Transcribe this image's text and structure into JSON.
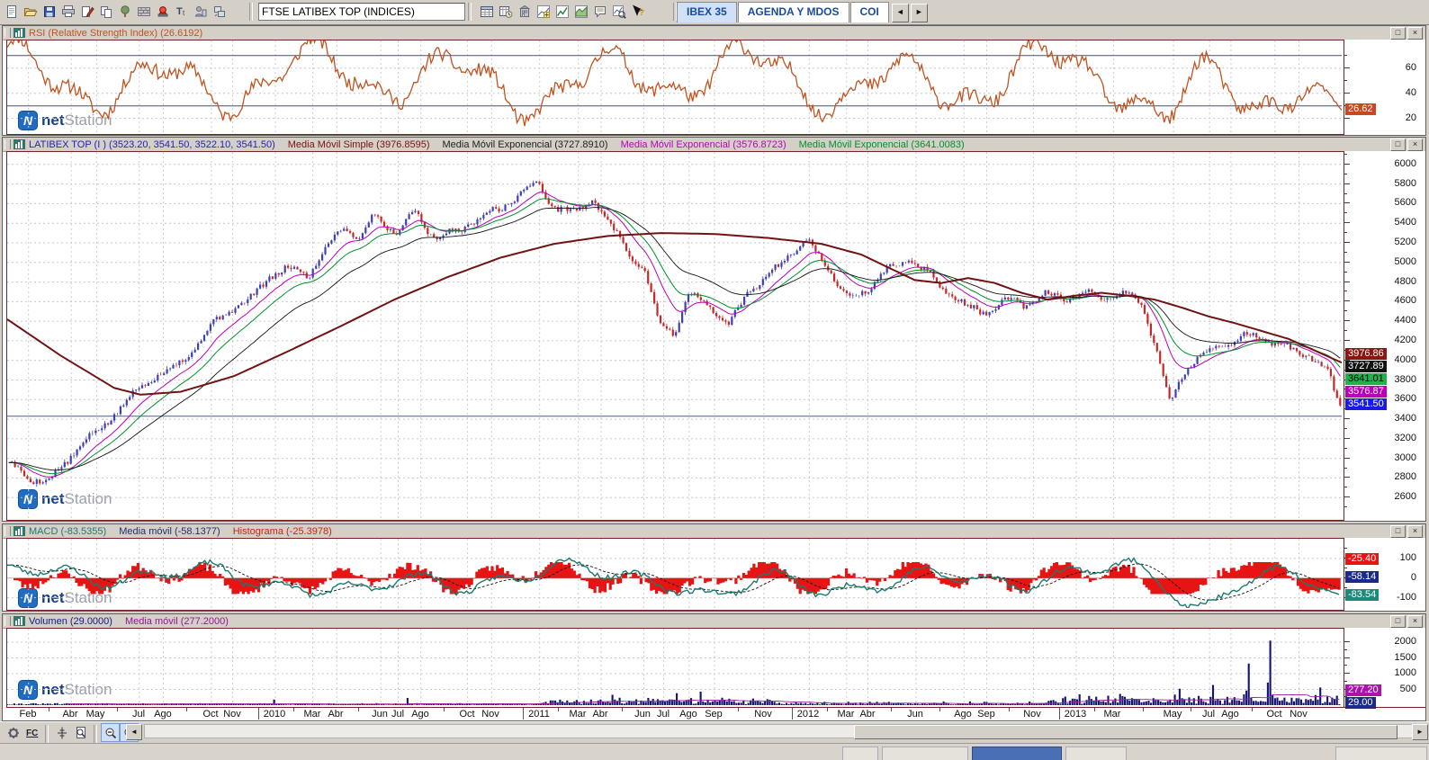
{
  "toolbar_top": {
    "symbol_value": "FTSE LATIBEX TOP (INDICES)",
    "left_icons": [
      "new-document-icon",
      "open-folder-icon",
      "save-icon",
      "print-icon",
      "edit-confirm-icon",
      "copy-icon",
      "tree-view-icon",
      "brick-wall-icon",
      "alarm-icon",
      "font-size-icon",
      "chart-user-icon",
      "send-window-icon"
    ],
    "mid_icons": [
      "data-table-icon",
      "quote-clock-icon",
      "market-building-icon",
      "chart-add-icon",
      "chart-line-icon",
      "chart-area-icon",
      "news-note-icon",
      "chart-search-icon",
      "help-cursor-icon"
    ],
    "tabs": [
      {
        "label": "IBEX 35",
        "active": true
      },
      {
        "label": "AGENDA Y MDOS",
        "active": false
      },
      {
        "label": "COI",
        "active": false,
        "truncated": true
      }
    ]
  },
  "ui": {
    "window_buttons": {
      "maximize": "□",
      "close": "×"
    },
    "scroll_left": "◄",
    "scroll_right": "►",
    "fc_label": "FC"
  },
  "watermark": {
    "n": "N",
    "net": "net",
    "station": "Station"
  },
  "panels": {
    "rsi": {
      "legend": [
        {
          "text": "RSI (Relative Strength Index) (26.6192)",
          "color": "#c0531f"
        }
      ],
      "yticks": [
        60,
        40,
        20
      ],
      "badges": [
        {
          "text": "26.62",
          "value": 26.62,
          "bg": "#c7491f",
          "fg": "#ffffff"
        }
      ]
    },
    "price": {
      "legend": [
        {
          "text": "LATIBEX TOP (I ) (3523.20, 3541.50, 3522.10, 3541.50)",
          "color": "#2222bb"
        },
        {
          "text": "Media Móvil Simple (3976.8595)",
          "color": "#7b1010"
        },
        {
          "text": "Media Móvil Exponencial (3727.8910)",
          "color": "#202020"
        },
        {
          "text": "Media Móvil Exponencial (3576.8723)",
          "color": "#bb00bb"
        },
        {
          "text": "Media Móvil Exponencial (3641.0083)",
          "color": "#00912c"
        }
      ],
      "yticks": [
        6000,
        5800,
        5600,
        5400,
        5200,
        5000,
        4800,
        4600,
        4400,
        4200,
        4000,
        3800,
        3600,
        3400,
        3200,
        3000,
        2800,
        2600
      ],
      "badges": [
        {
          "text": "3976.86",
          "value": 3976.86,
          "bg": "#8b1510",
          "fg": "#ffffff"
        },
        {
          "text": "3727.89",
          "value": 3727.89,
          "bg": "#111111",
          "fg": "#ffffff"
        },
        {
          "text": "3641.01",
          "value": 3641.01,
          "bg": "#22b14c",
          "fg": "#000000"
        },
        {
          "text": "3576.87",
          "value": 3576.87,
          "bg": "#bb00bb",
          "fg": "#ffffff"
        },
        {
          "text": "3541.50",
          "value": 3541.5,
          "bg": "#1a1ae6",
          "fg": "#ffffff"
        }
      ]
    },
    "macd": {
      "legend": [
        {
          "text": "MACD (-83.5355)",
          "color": "#1b7a70"
        },
        {
          "text": "Media móvil (-58.1377)",
          "color": "#20306c"
        },
        {
          "text": "Histograma (-25.3978)",
          "color": "#d02010"
        }
      ],
      "yticks": [
        100,
        0,
        -100
      ],
      "badges": [
        {
          "text": "-25.40",
          "value": -25.4,
          "bg": "#e81414",
          "fg": "#ffffff"
        },
        {
          "text": "-58.14",
          "value": -58.14,
          "bg": "#1a2a8c",
          "fg": "#ffffff"
        },
        {
          "text": "-83.54",
          "value": -83.54,
          "bg": "#1b8a7a",
          "fg": "#ffffff"
        }
      ]
    },
    "volume": {
      "legend": [
        {
          "text": "Volumen (29.0000)",
          "color": "#101a80"
        },
        {
          "text": "Media móvil (277.2000)",
          "color": "#901890"
        }
      ],
      "yticks": [
        2000,
        1500,
        1000,
        500
      ],
      "badges": [
        {
          "text": "277.20",
          "value": 277.2,
          "bg": "#a915a9",
          "fg": "#ffffff"
        },
        {
          "text": "29.00",
          "value": 29.0,
          "bg": "#1a2a8c",
          "fg": "#ffffff"
        }
      ]
    }
  },
  "xaxis": {
    "labels": [
      {
        "t": "Feb",
        "x": 0.016
      },
      {
        "t": "Abr",
        "x": 0.048
      },
      {
        "t": "May",
        "x": 0.067
      },
      {
        "t": "Jul",
        "x": 0.099
      },
      {
        "t": "Ago",
        "x": 0.117
      },
      {
        "t": "Oct",
        "x": 0.153
      },
      {
        "t": "Nov",
        "x": 0.169
      },
      {
        "t": "2010",
        "x": 0.201,
        "year": true
      },
      {
        "t": "Mar",
        "x": 0.229
      },
      {
        "t": "Abr",
        "x": 0.247
      },
      {
        "t": "Jun",
        "x": 0.28
      },
      {
        "t": "Jul",
        "x": 0.293
      },
      {
        "t": "Ago",
        "x": 0.31
      },
      {
        "t": "Oct",
        "x": 0.345
      },
      {
        "t": "Nov",
        "x": 0.363
      },
      {
        "t": "2011",
        "x": 0.399,
        "year": true
      },
      {
        "t": "Mar",
        "x": 0.428
      },
      {
        "t": "Abr",
        "x": 0.445
      },
      {
        "t": "Jun",
        "x": 0.477
      },
      {
        "t": "Jul",
        "x": 0.492
      },
      {
        "t": "Ago",
        "x": 0.511
      },
      {
        "t": "Sep",
        "x": 0.53
      },
      {
        "t": "Nov",
        "x": 0.567
      },
      {
        "t": "2012",
        "x": 0.601,
        "year": true
      },
      {
        "t": "Mar",
        "x": 0.629
      },
      {
        "t": "Abr",
        "x": 0.645
      },
      {
        "t": "Jun",
        "x": 0.681
      },
      {
        "t": "Ago",
        "x": 0.717
      },
      {
        "t": "Sep",
        "x": 0.734
      },
      {
        "t": "Nov",
        "x": 0.769
      },
      {
        "t": "2013",
        "x": 0.801,
        "year": true
      },
      {
        "t": "Mar",
        "x": 0.829
      },
      {
        "t": "May",
        "x": 0.874
      },
      {
        "t": "Jul",
        "x": 0.901
      },
      {
        "t": "Ago",
        "x": 0.917
      },
      {
        "t": "Oct",
        "x": 0.95
      },
      {
        "t": "Nov",
        "x": 0.968
      }
    ]
  },
  "toolbar_bottom": {
    "icons": [
      {
        "name": "settings-gear-icon",
        "pressed": false
      },
      {
        "name": "fc-mode-icon",
        "pressed": false
      },
      {
        "name": "crosshair-icon",
        "pressed": false
      },
      {
        "name": "page-preview-icon",
        "pressed": false
      },
      {
        "name": "zoom-out-icon",
        "pressed": true
      },
      {
        "name": "zoom-in-icon",
        "pressed": true
      }
    ]
  },
  "chart_data": [
    {
      "type": "line",
      "id": "rsi",
      "title": "RSI (Relative Strength Index)",
      "current": 26.6192,
      "levels": [
        70,
        30
      ],
      "yticks": [
        20,
        40,
        60
      ],
      "yrange": [
        9,
        82
      ],
      "line_color": "#c0531f"
    },
    {
      "type": "candlestick",
      "id": "price",
      "title": "LATIBEX TOP (I)",
      "ohlc_current": {
        "open": 3523.2,
        "high": 3541.5,
        "low": 3522.1,
        "close": 3541.5
      },
      "overlays": [
        {
          "name": "Media Móvil Simple",
          "value": 3976.8595,
          "color": "#7b1010"
        },
        {
          "name": "Media Móvil Exponencial",
          "value": 3727.891,
          "color": "#202020"
        },
        {
          "name": "Media Móvil Exponencial",
          "value": 3576.8723,
          "color": "#bb00bb"
        },
        {
          "name": "Media Móvil Exponencial",
          "value": 3641.0083,
          "color": "#00912c"
        }
      ],
      "support_level": 3430,
      "yrange": [
        2391,
        6127
      ],
      "yticks_step": 200,
      "price_anchors": [
        [
          0,
          2950
        ],
        [
          0.015,
          2800
        ],
        [
          0.03,
          2760
        ],
        [
          0.05,
          3080
        ],
        [
          0.07,
          3320
        ],
        [
          0.09,
          3600
        ],
        [
          0.105,
          3810
        ],
        [
          0.12,
          3900
        ],
        [
          0.135,
          4050
        ],
        [
          0.15,
          4320
        ],
        [
          0.165,
          4520
        ],
        [
          0.18,
          4600
        ],
        [
          0.195,
          4850
        ],
        [
          0.21,
          4940
        ],
        [
          0.225,
          4870
        ],
        [
          0.24,
          5180
        ],
        [
          0.252,
          5380
        ],
        [
          0.262,
          5240
        ],
        [
          0.275,
          5480
        ],
        [
          0.29,
          5300
        ],
        [
          0.305,
          5520
        ],
        [
          0.32,
          5240
        ],
        [
          0.34,
          5340
        ],
        [
          0.355,
          5480
        ],
        [
          0.37,
          5550
        ],
        [
          0.385,
          5720
        ],
        [
          0.398,
          5800
        ],
        [
          0.41,
          5560
        ],
        [
          0.425,
          5510
        ],
        [
          0.438,
          5650
        ],
        [
          0.45,
          5420
        ],
        [
          0.465,
          5120
        ],
        [
          0.478,
          4880
        ],
        [
          0.488,
          4420
        ],
        [
          0.5,
          4280
        ],
        [
          0.512,
          4680
        ],
        [
          0.525,
          4580
        ],
        [
          0.54,
          4330
        ],
        [
          0.553,
          4680
        ],
        [
          0.568,
          4820
        ],
        [
          0.585,
          5080
        ],
        [
          0.6,
          5230
        ],
        [
          0.615,
          4950
        ],
        [
          0.63,
          4620
        ],
        [
          0.645,
          4730
        ],
        [
          0.66,
          4920
        ],
        [
          0.675,
          5040
        ],
        [
          0.69,
          4890
        ],
        [
          0.705,
          4700
        ],
        [
          0.72,
          4540
        ],
        [
          0.735,
          4480
        ],
        [
          0.75,
          4620
        ],
        [
          0.765,
          4560
        ],
        [
          0.78,
          4680
        ],
        [
          0.795,
          4620
        ],
        [
          0.81,
          4680
        ],
        [
          0.825,
          4650
        ],
        [
          0.84,
          4680
        ],
        [
          0.852,
          4560
        ],
        [
          0.862,
          4100
        ],
        [
          0.872,
          3560
        ],
        [
          0.885,
          3950
        ],
        [
          0.9,
          4080
        ],
        [
          0.915,
          4180
        ],
        [
          0.93,
          4260
        ],
        [
          0.945,
          4200
        ],
        [
          0.96,
          4130
        ],
        [
          0.975,
          4060
        ],
        [
          0.99,
          3900
        ],
        [
          1,
          3541.5
        ]
      ],
      "sma_anchors": [
        [
          0,
          4420
        ],
        [
          0.04,
          4050
        ],
        [
          0.08,
          3720
        ],
        [
          0.1,
          3650
        ],
        [
          0.13,
          3680
        ],
        [
          0.17,
          3840
        ],
        [
          0.21,
          4090
        ],
        [
          0.25,
          4350
        ],
        [
          0.29,
          4620
        ],
        [
          0.33,
          4850
        ],
        [
          0.37,
          5050
        ],
        [
          0.41,
          5190
        ],
        [
          0.45,
          5270
        ],
        [
          0.49,
          5300
        ],
        [
          0.53,
          5290
        ],
        [
          0.57,
          5250
        ],
        [
          0.61,
          5190
        ],
        [
          0.64,
          5080
        ],
        [
          0.66,
          4950
        ],
        [
          0.68,
          4820
        ],
        [
          0.7,
          4790
        ],
        [
          0.72,
          4840
        ],
        [
          0.74,
          4790
        ],
        [
          0.76,
          4690
        ],
        [
          0.78,
          4620
        ],
        [
          0.8,
          4660
        ],
        [
          0.82,
          4690
        ],
        [
          0.84,
          4660
        ],
        [
          0.86,
          4620
        ],
        [
          0.88,
          4540
        ],
        [
          0.9,
          4450
        ],
        [
          0.92,
          4380
        ],
        [
          0.94,
          4300
        ],
        [
          0.96,
          4220
        ],
        [
          0.98,
          4100
        ],
        [
          1,
          3976.86
        ]
      ]
    },
    {
      "type": "macd",
      "id": "macd",
      "current": {
        "macd": -83.5355,
        "signal": -58.1377,
        "histogram": -25.3978
      },
      "yrange": [
        -152,
        200
      ],
      "zero": 0,
      "colors": {
        "macd": "#1b7a70",
        "signal": "#111111",
        "histogram": "#e81414"
      }
    },
    {
      "type": "bar",
      "id": "volume",
      "current": 29.0,
      "moving_average": 277.2,
      "yticks": [
        500,
        1000,
        1500,
        2000
      ],
      "yrange": [
        0,
        2200
      ],
      "bar_color": "#14146e",
      "spikes": [
        [
          0.949,
          2050
        ],
        [
          0.932,
          1320
        ],
        [
          0.905,
          640
        ],
        [
          0.88,
          520
        ],
        [
          0.985,
          560
        ],
        [
          0.52,
          430
        ],
        [
          0.503,
          380
        ],
        [
          0.455,
          330
        ],
        [
          0.3,
          230
        ],
        [
          0.2,
          180
        ]
      ]
    }
  ]
}
